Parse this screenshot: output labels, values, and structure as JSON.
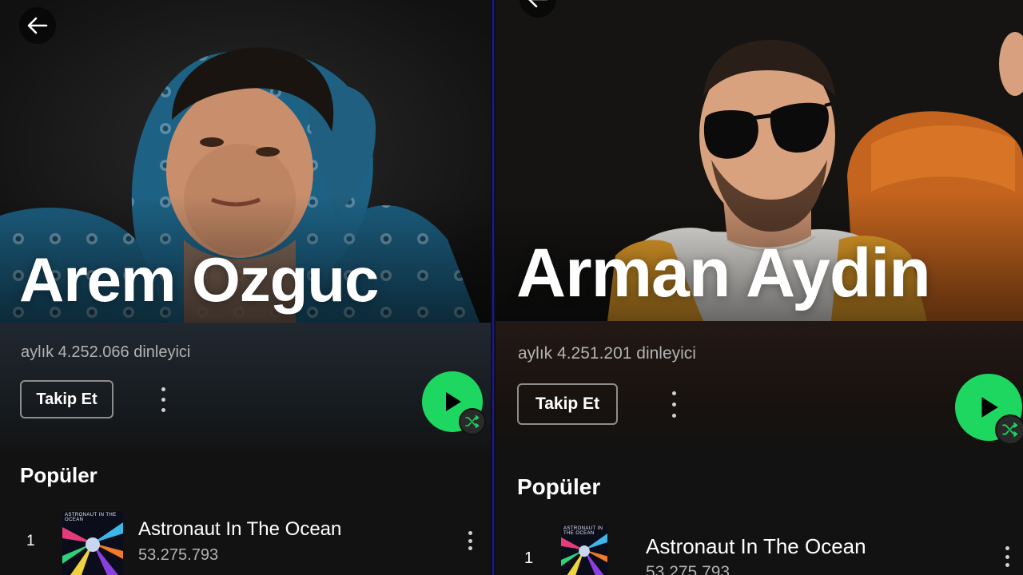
{
  "left": {
    "artist_name": "Arem Ozguc",
    "listeners": "aylık 4.252.066 dinleyici",
    "follow_label": "Takip Et",
    "section_title": "Popüler",
    "track": {
      "number": "1",
      "title": "Astronaut In The Ocean",
      "plays": "53.275.793",
      "cover_text": "ASTRONAUT IN THE OCEAN"
    }
  },
  "right": {
    "artist_name": "Arman Aydin",
    "listeners": "aylık 4.251.201 dinleyici",
    "follow_label": "Takip Et",
    "section_title": "Popüler",
    "track": {
      "number": "1",
      "title": "Astronaut In The Ocean",
      "plays": "53.275.793",
      "cover_text": "ASTRONAUT IN THE OCEAN"
    }
  },
  "colors": {
    "accent_green": "#1ed760",
    "background": "#121212",
    "secondary_text": "#b3b3b3",
    "divider": "#1c1c8a"
  },
  "icons": [
    "arrow-left-icon",
    "more-vertical-icon",
    "play-icon",
    "shuffle-icon"
  ]
}
